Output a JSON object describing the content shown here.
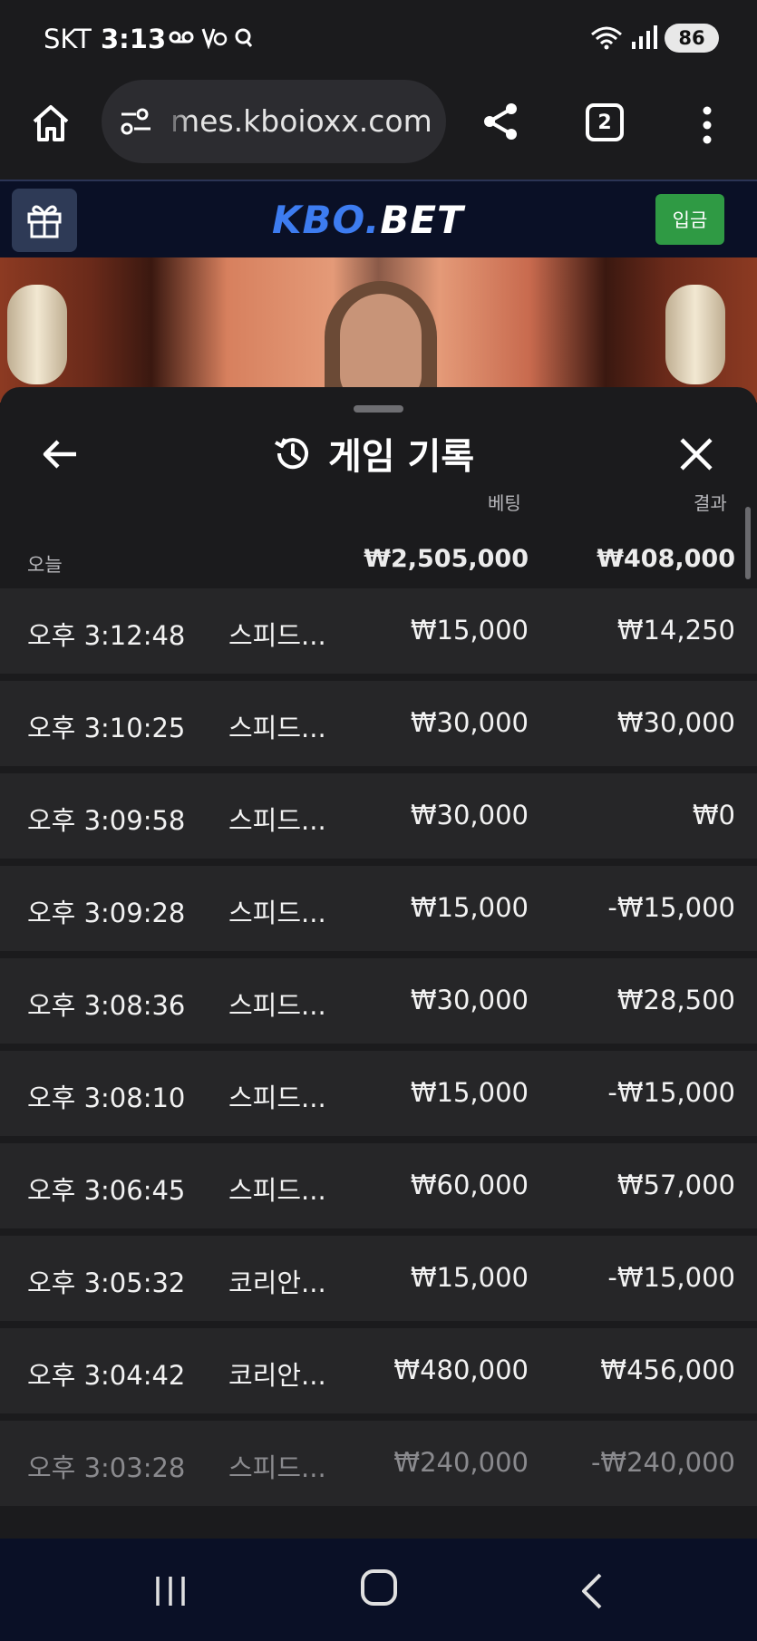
{
  "status_bar": {
    "carrier": "SKT",
    "time": "3:13",
    "battery": "86"
  },
  "browser": {
    "url": "mes.kboioxx.com",
    "tab_count": "2"
  },
  "site": {
    "logo_kbo": "KBO",
    "logo_dot": ".",
    "logo_bet": "BET",
    "deposit_label": "입금"
  },
  "sheet": {
    "title": "게임 기록",
    "col_bet": "베팅",
    "col_result": "결과",
    "today_label": "오늘",
    "total_bet": "₩2,505,000",
    "total_result": "₩408,000"
  },
  "rows": [
    {
      "time": "오후 3:12:48",
      "game": "스피드...",
      "bet": "₩15,000",
      "result": "₩14,250"
    },
    {
      "time": "오후 3:10:25",
      "game": "스피드...",
      "bet": "₩30,000",
      "result": "₩30,000"
    },
    {
      "time": "오후 3:09:58",
      "game": "스피드...",
      "bet": "₩30,000",
      "result": "₩0"
    },
    {
      "time": "오후 3:09:28",
      "game": "스피드...",
      "bet": "₩15,000",
      "result": "-₩15,000"
    },
    {
      "time": "오후 3:08:36",
      "game": "스피드...",
      "bet": "₩30,000",
      "result": "₩28,500"
    },
    {
      "time": "오후 3:08:10",
      "game": "스피드...",
      "bet": "₩15,000",
      "result": "-₩15,000"
    },
    {
      "time": "오후 3:06:45",
      "game": "스피드...",
      "bet": "₩60,000",
      "result": "₩57,000"
    },
    {
      "time": "오후 3:05:32",
      "game": "코리안...",
      "bet": "₩15,000",
      "result": "-₩15,000"
    },
    {
      "time": "오후 3:04:42",
      "game": "코리안...",
      "bet": "₩480,000",
      "result": "₩456,000"
    },
    {
      "time": "오후 3:03:28",
      "game": "스피드...",
      "bet": "₩240,000",
      "result": "-₩240,000"
    }
  ],
  "colors": {
    "accent_blue": "#3d7cf0",
    "deposit_green": "#2f9a44",
    "header_navy": "#0a1026"
  },
  "icons": {
    "home": "home-icon",
    "share": "share-icon",
    "menu": "more-vertical-icon",
    "gift": "gift-icon",
    "history": "history-icon",
    "back": "arrow-left-icon",
    "close": "close-icon"
  }
}
